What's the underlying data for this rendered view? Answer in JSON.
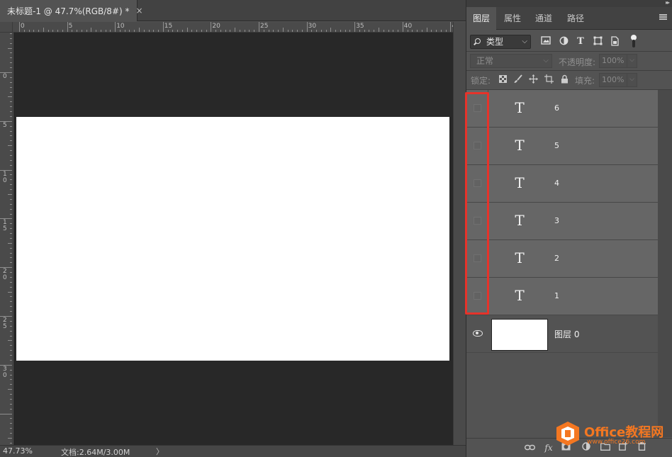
{
  "document": {
    "tab_title": "未标题-1 @ 47.7%(RGB/8#) *",
    "close_glyph": "×",
    "ruler_h_labels": [
      "0",
      "5",
      "10",
      "15",
      "20",
      "25",
      "30",
      "35",
      "40",
      "4"
    ],
    "ruler_v_labels": [
      "5",
      "0",
      "5",
      "1\n0",
      "1\n5",
      "2\n0",
      "2\n5",
      "3\n0"
    ],
    "canvas_color": "#ffffff",
    "pasteboard_color": "#282828"
  },
  "status": {
    "zoom": "47.73%",
    "doc_info": "文档:2.64M/3.00M",
    "arrow": "〉"
  },
  "panel": {
    "tabs": [
      "图层",
      "属性",
      "通道",
      "路径"
    ],
    "active_tab": 0,
    "filter_kind": "类型",
    "filter_icons": [
      "image-filter-icon",
      "adjustment-filter-icon",
      "type-filter-icon",
      "shape-filter-icon",
      "smart-object-filter-icon"
    ],
    "blend_mode": "正常",
    "opacity_label": "不透明度:",
    "opacity_value": "100%",
    "lock_label": "锁定:",
    "fill_label": "填充:",
    "fill_value": "100%"
  },
  "layers": [
    {
      "name": "6",
      "type": "text",
      "visible": false
    },
    {
      "name": "5",
      "type": "text",
      "visible": false
    },
    {
      "name": "4",
      "type": "text",
      "visible": false
    },
    {
      "name": "3",
      "type": "text",
      "visible": false
    },
    {
      "name": "2",
      "type": "text",
      "visible": false
    },
    {
      "name": "1",
      "type": "text",
      "visible": false
    },
    {
      "name": "图层 0",
      "type": "raster",
      "visible": true
    }
  ],
  "text_layer_glyph": "T",
  "highlight_color": "#e6332a",
  "watermark": {
    "brand": "Office教程网",
    "url": "www.office26.com",
    "color": "#f47721"
  }
}
